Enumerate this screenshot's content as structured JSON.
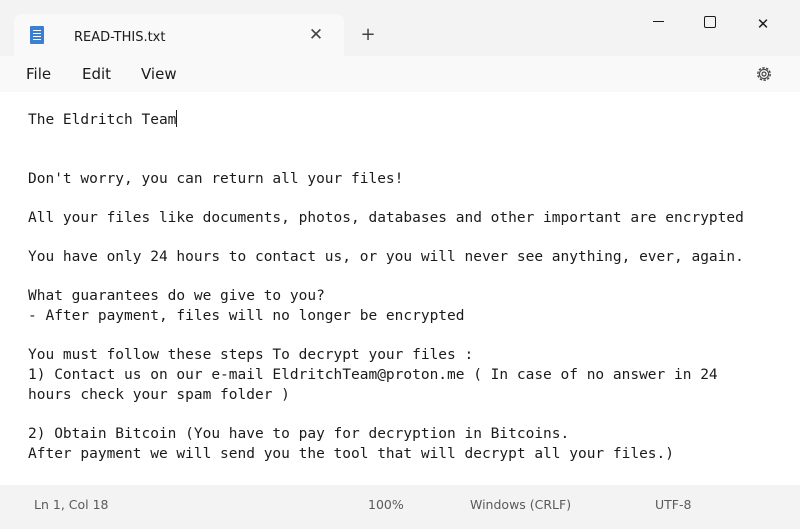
{
  "tab": {
    "title": "READ-THIS.txt",
    "close_glyph": "✕",
    "new_glyph": "+"
  },
  "window": {
    "minimize_icon": "minimize-icon",
    "maximize_icon": "maximize-icon",
    "close_glyph": "✕"
  },
  "menu": {
    "file": "File",
    "edit": "Edit",
    "view": "View",
    "settings_icon": "gear-icon"
  },
  "document": {
    "lines": [
      "The Eldritch Team",
      "Don't worry, you can return all your files!",
      "All your files like documents, photos, databases and other important are encrypted",
      "You have only 24 hours to contact us, or you will never see anything, ever, again.",
      "What guarantees do we give to you?",
      "- After payment, files will no longer be encrypted",
      "You must follow these steps To decrypt your files :",
      "1) Contact us on our e-mail EldritchTeam@proton.me ( In case of no answer in 24",
      "hours check your spam folder )",
      "2) Obtain Bitcoin (You have to pay for decryption in Bitcoins.",
      "After payment we will send you the tool that will decrypt all your files.)"
    ]
  },
  "status": {
    "position": "Ln 1, Col 18",
    "zoom": "100%",
    "line_ending": "Windows (CRLF)",
    "encoding": "UTF-8"
  }
}
